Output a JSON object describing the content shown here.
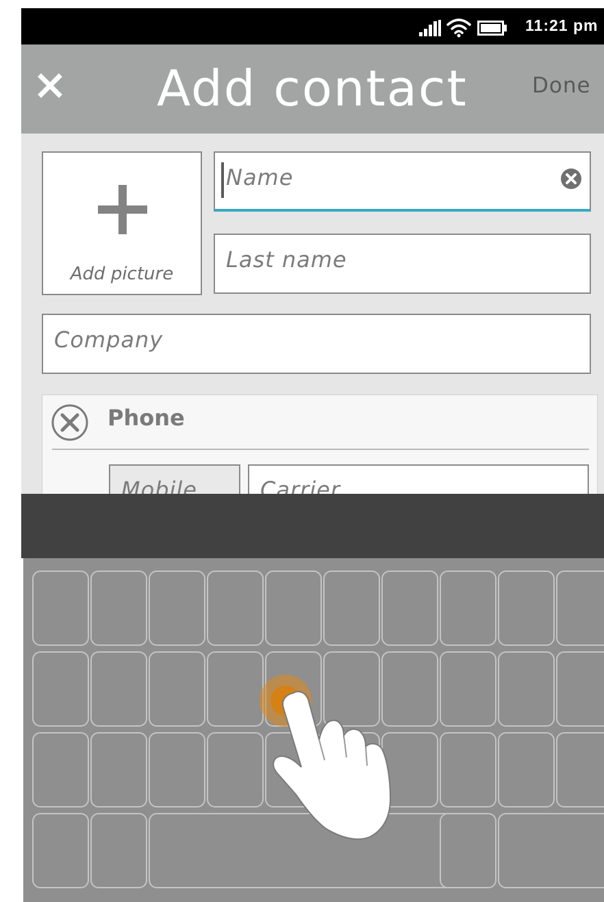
{
  "status_bar": {
    "time": "11:21 pm",
    "icons": [
      "signal-icon",
      "wifi-icon",
      "battery-icon"
    ]
  },
  "header": {
    "close_icon": "close-icon",
    "title": "Add contact",
    "done_label": "Done"
  },
  "form": {
    "add_picture_label": "Add picture",
    "name_placeholder": "Name",
    "last_name_placeholder": "Last name",
    "company_placeholder": "Company",
    "phone": {
      "label": "Phone",
      "type_value": "Mobile",
      "carrier_placeholder": "Carrier"
    }
  },
  "colors": {
    "header_bg": "#a3a5a4",
    "form_bg": "#e6e6e6",
    "focus_accent": "#3aa9c1",
    "keyboard_bar": "#414141",
    "keyboard_bg": "#8f8f8f",
    "touch_indicator": "#e08a1a"
  },
  "keyboard": {
    "rows": 4,
    "note_icon": "hand-pointer-icon"
  }
}
